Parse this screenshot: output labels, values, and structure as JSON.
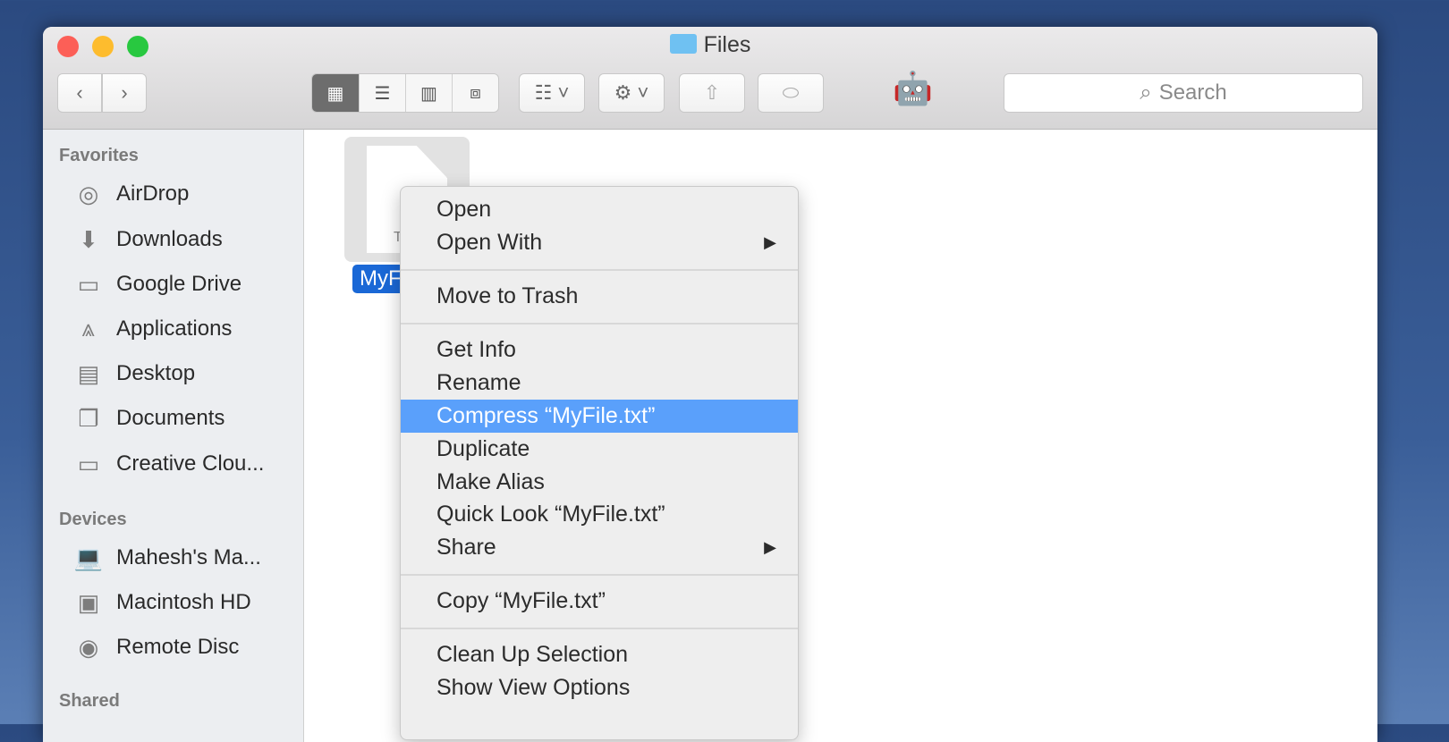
{
  "window": {
    "title": "Files"
  },
  "toolbar": {
    "back": "‹",
    "forward": "›",
    "search_placeholder": "Search"
  },
  "sidebar": {
    "favorites_header": "Favorites",
    "favorites": [
      {
        "label": "AirDrop",
        "icon": "airdrop-icon"
      },
      {
        "label": "Downloads",
        "icon": "downloads-icon"
      },
      {
        "label": "Google Drive",
        "icon": "folder-icon"
      },
      {
        "label": "Applications",
        "icon": "applications-icon"
      },
      {
        "label": "Desktop",
        "icon": "desktop-icon"
      },
      {
        "label": "Documents",
        "icon": "documents-icon"
      },
      {
        "label": "Creative Clou...",
        "icon": "folder-icon"
      }
    ],
    "devices_header": "Devices",
    "devices": [
      {
        "label": "Mahesh's Ma...",
        "icon": "laptop-icon"
      },
      {
        "label": "Macintosh HD",
        "icon": "harddisk-icon"
      },
      {
        "label": "Remote Disc",
        "icon": "disc-icon"
      }
    ],
    "shared_header": "Shared"
  },
  "file": {
    "name": "MyF",
    "icon_text": "T"
  },
  "context_menu": {
    "items": [
      "Open",
      "Open With",
      "Move to Trash",
      "Get Info",
      "Rename",
      "Compress “MyFile.txt”",
      "Duplicate",
      "Make Alias",
      "Quick Look “MyFile.txt”",
      "Share",
      "Copy “MyFile.txt”",
      "Clean Up Selection",
      "Show View Options"
    ],
    "submenu_arrow": "▶"
  },
  "colors": {
    "highlight": "#5aa0fb",
    "selection": "#1a68d6"
  }
}
